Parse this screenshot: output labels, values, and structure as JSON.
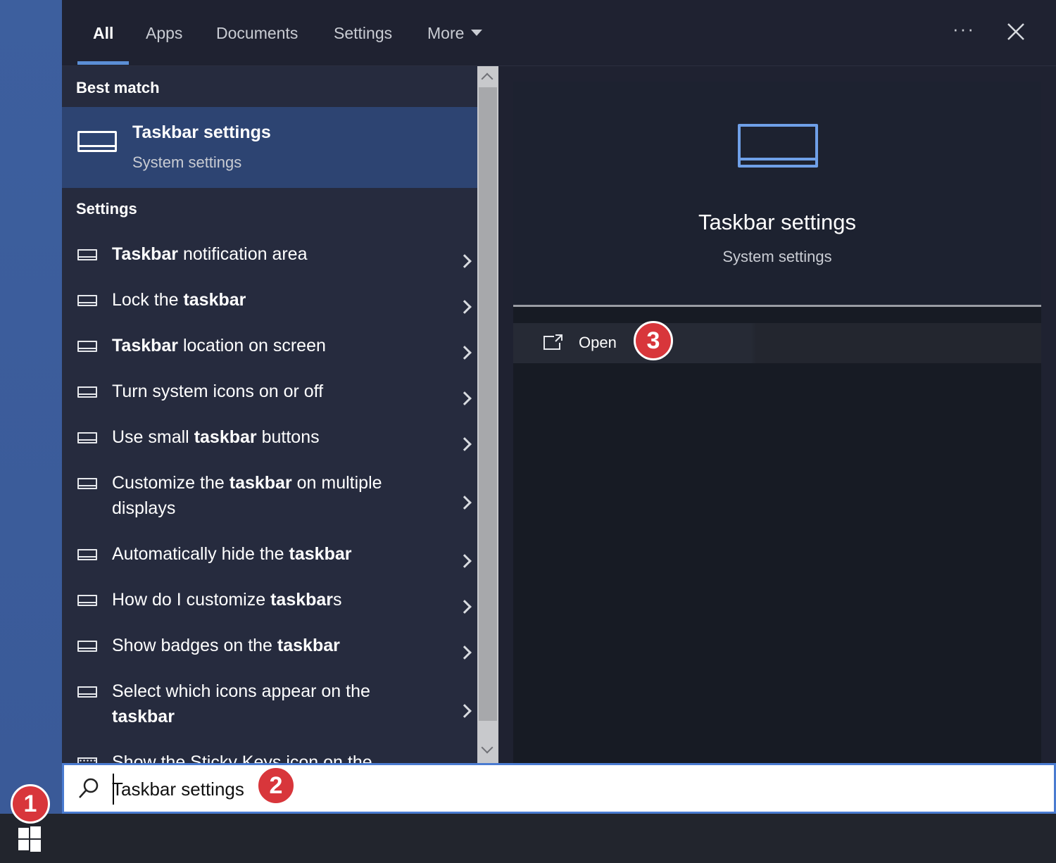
{
  "tabs": [
    {
      "label": "All",
      "active": true
    },
    {
      "label": "Apps"
    },
    {
      "label": "Documents"
    },
    {
      "label": "Settings"
    },
    {
      "label": "More"
    }
  ],
  "header": {
    "ellipsis": "···",
    "close_icon": "close-icon"
  },
  "best_match": {
    "section_label": "Best match",
    "title": "Taskbar settings",
    "subtitle": "System settings",
    "icon": "taskbar-icon"
  },
  "settings": {
    "section_label": "Settings",
    "items": [
      {
        "segments": [
          {
            "t": "Taskbar",
            "b": true
          },
          {
            "t": " notification area"
          }
        ]
      },
      {
        "segments": [
          {
            "t": "Lock the "
          },
          {
            "t": "taskbar",
            "b": true
          }
        ]
      },
      {
        "segments": [
          {
            "t": "Taskbar",
            "b": true
          },
          {
            "t": " location on screen"
          }
        ]
      },
      {
        "segments": [
          {
            "t": "Turn system icons on or off"
          }
        ]
      },
      {
        "segments": [
          {
            "t": "Use small "
          },
          {
            "t": "taskbar",
            "b": true
          },
          {
            "t": " buttons"
          }
        ]
      },
      {
        "segments": [
          {
            "t": "Customize the "
          },
          {
            "t": "taskbar",
            "b": true
          },
          {
            "t": " on multiple displays"
          }
        ]
      },
      {
        "segments": [
          {
            "t": "Automatically hide the "
          },
          {
            "t": "taskbar",
            "b": true
          }
        ]
      },
      {
        "segments": [
          {
            "t": "How do I customize "
          },
          {
            "t": "taskbar",
            "b": true
          },
          {
            "t": "s"
          }
        ]
      },
      {
        "segments": [
          {
            "t": "Show badges on the "
          },
          {
            "t": "taskbar",
            "b": true
          }
        ]
      },
      {
        "segments": [
          {
            "t": "Select which icons appear on the "
          },
          {
            "t": "taskbar",
            "b": true
          }
        ]
      },
      {
        "segments": [
          {
            "t": "Show the Sticky Keys icon on the"
          }
        ]
      }
    ]
  },
  "preview": {
    "title": "Taskbar settings",
    "subtitle": "System settings",
    "icon": "taskbar-icon",
    "action_label": "Open",
    "action_icon": "open-external-icon"
  },
  "search": {
    "value": "Taskbar settings",
    "icon": "search-icon"
  },
  "taskbar": {
    "start_icon": "windows-logo-icon"
  },
  "callouts": [
    "1",
    "2",
    "3"
  ],
  "colors": {
    "accent": "#4a7bd0",
    "selection": "#2d4472",
    "badge": "#d8363b"
  }
}
